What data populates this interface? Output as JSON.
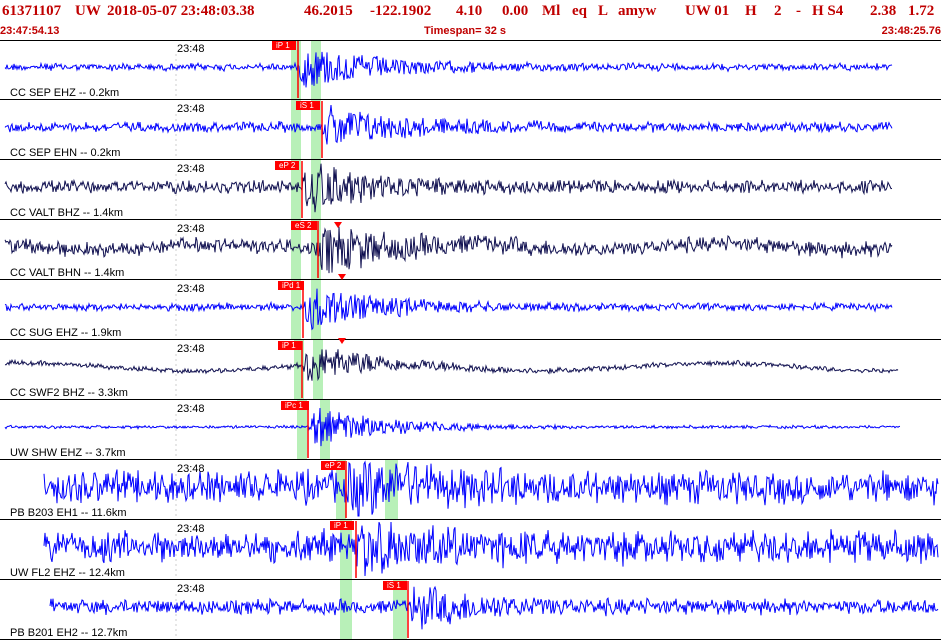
{
  "header": {
    "evid": "61371107",
    "network": "UW",
    "datetime": "2018-05-07 23:48:03.38",
    "lat": "46.2015",
    "lon": "-122.1902",
    "depth": "4.10",
    "mag": "0.00",
    "magtype": "Ml",
    "etype": "eq",
    "qual": "L",
    "analyst": "amyw",
    "src": "UW 01",
    "h1": "H",
    "h2": "2",
    "h3": "-",
    "h4": "H S4",
    "v1": "2.38",
    "v2": "1.72",
    "start_time": "23:47:54.13",
    "timespan": "Timespan=  32 s",
    "end_time": "23:48:25.76"
  },
  "colors": {
    "trace_blue": "#0000ff",
    "trace_navy": "#101050",
    "pick_red": "#ff0000",
    "window_green": "#b8f0b8",
    "header_red": "#c00000",
    "divider": "#000000"
  },
  "traces": [
    {
      "station": "CC SEP EHZ -- 0.2km",
      "minute": "23:48",
      "color": "blue",
      "picks": [
        {
          "label": "iP 1"
        }
      ]
    },
    {
      "station": "CC SEP EHN -- 0.2km",
      "minute": "23:48",
      "color": "blue",
      "picks": [
        {
          "label": "iS 1"
        }
      ]
    },
    {
      "station": "CC VALT BHZ -- 1.4km",
      "minute": "23:48",
      "color": "navy",
      "picks": [
        {
          "label": "eP 2"
        }
      ]
    },
    {
      "station": "CC VALT BHN -- 1.4km",
      "minute": "23:48",
      "color": "navy",
      "picks": [
        {
          "label": "eS 2"
        }
      ]
    },
    {
      "station": "CC SUG EHZ -- 1.9km",
      "minute": "23:48",
      "color": "blue",
      "picks": [
        {
          "label": "iPd 1"
        }
      ]
    },
    {
      "station": "CC SWF2 BHZ -- 3.3km",
      "minute": "23:48",
      "color": "navy",
      "picks": [
        {
          "label": "iP 1"
        }
      ]
    },
    {
      "station": "UW SHW EHZ -- 3.7km",
      "minute": "23:48",
      "color": "blue",
      "picks": [
        {
          "label": "iPc 1"
        }
      ]
    },
    {
      "station": "PB B203 EH1 -- 11.6km",
      "minute": "23:48",
      "color": "blue",
      "picks": [
        {
          "label": "eP 2"
        }
      ]
    },
    {
      "station": "UW FL2 EHZ -- 12.4km",
      "minute": "23:48",
      "color": "blue",
      "picks": [
        {
          "label": "iP 1"
        }
      ]
    },
    {
      "station": "PB B201 EH2 -- 12.7km",
      "minute": "23:48",
      "color": "blue",
      "picks": [
        {
          "label": "iS 1"
        }
      ]
    }
  ]
}
